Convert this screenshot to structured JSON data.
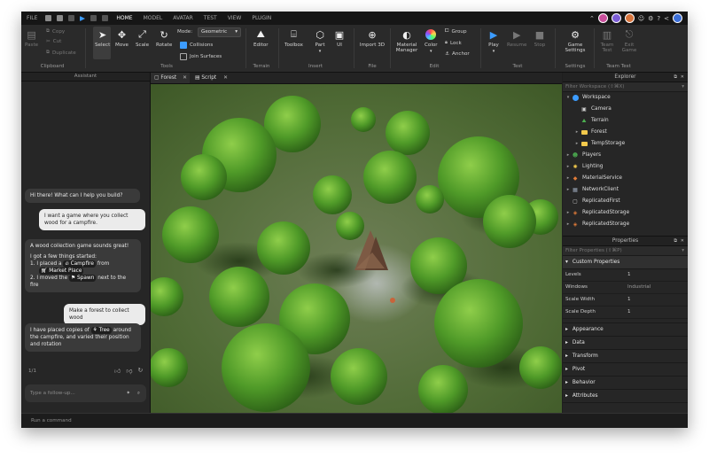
{
  "menu": {
    "file": "FILE",
    "tabs": [
      "HOME",
      "MODEL",
      "AVATAR",
      "TEST",
      "VIEW",
      "PLUGIN"
    ],
    "active_tab": "HOME"
  },
  "ribbon": {
    "clipboard": {
      "paste": "Paste",
      "copy": "Copy",
      "cut": "Cut",
      "duplicate": "Duplicate",
      "label": "Clipboard"
    },
    "tools": {
      "select": "Select",
      "move": "Move",
      "scale": "Scale",
      "rotate": "Rotate",
      "mode_label": "Mode:",
      "mode_value": "Geometric",
      "collisions": "Collisions",
      "join_surfaces": "Join Surfaces",
      "label": "Tools"
    },
    "terrain": {
      "editor": "Editor",
      "label": "Terrain"
    },
    "insert": {
      "toolbox": "Toolbox",
      "part": "Part",
      "ui": "UI",
      "label": "Insert"
    },
    "file": {
      "import": "Import 3D",
      "label": "File"
    },
    "edit": {
      "material_manager": "Material Manager",
      "color": "Color",
      "group": "Group",
      "lock": "Lock",
      "anchor": "Anchor",
      "label": "Edit"
    },
    "test": {
      "play": "Play",
      "resume": "Resume",
      "stop": "Stop",
      "label": "Test"
    },
    "settings": {
      "game_settings": "Game Settings",
      "label": "Settings"
    },
    "team_test": {
      "team_test": "Team Test",
      "exit_game": "Exit Game",
      "label": "Team Test"
    }
  },
  "assistant": {
    "title": "Assistant",
    "messages": {
      "m1": "Hi there! What can I help you build?",
      "m2": "I want a game where you collect wood for a campfire.",
      "m3_a": "A wood collection game sounds great!",
      "m3_b": "I got a few things started:",
      "m3_c1": "1. I placed a",
      "m3_chip1": "Campfire",
      "m3_c2": "from",
      "m3_chip2": "Market Place",
      "m3_d1": "2. I moved the",
      "m3_chip3": "Spawn",
      "m3_d2": "next to the fire",
      "m4": "Make a forest to collect wood",
      "m5_a": "I have placed copies of",
      "m5_chip": "Tree",
      "m5_b": "around the campfire, and varied their position and rotation"
    },
    "pager": "1/1",
    "follow_placeholder": "Type a follow-up..."
  },
  "editor_tabs": [
    {
      "label": "Forest"
    },
    {
      "label": "Script"
    }
  ],
  "explorer": {
    "title": "Explorer",
    "filter": "Filter Workspace (⇧⌘X)",
    "items": [
      {
        "label": "Workspace",
        "color": "#3c9cff"
      },
      {
        "label": "Camera",
        "color": "#cfcfcf"
      },
      {
        "label": "Terrain",
        "color": "#4caf50"
      },
      {
        "label": "Forest",
        "color": "#f2c94c"
      },
      {
        "label": "TempStorage",
        "color": "#f2c94c"
      },
      {
        "label": "Players",
        "color": "#4caf50"
      },
      {
        "label": "Lighting",
        "color": "#f2c94c"
      },
      {
        "label": "MaterialService",
        "color": "#e07b39"
      },
      {
        "label": "NetworkClient",
        "color": "#9aa6b8"
      },
      {
        "label": "ReplicatedFirst",
        "color": "#cfcfcf"
      },
      {
        "label": "ReplicatedStorage",
        "color": "#e07b39"
      },
      {
        "label": "ReplicatedStorage",
        "color": "#e07b39"
      }
    ]
  },
  "properties": {
    "title": "Properties",
    "filter": "Filter Properties (⇧⌘P)",
    "custom_header": "Custom Properties",
    "rows": [
      {
        "k": "Levels",
        "v": "1"
      },
      {
        "k": "Windows",
        "v": "Industrial"
      },
      {
        "k": "Scale Width",
        "v": "1"
      },
      {
        "k": "Scale Depth",
        "v": "1"
      }
    ],
    "sections": [
      "Appearance",
      "Data",
      "Transform",
      "Pivot",
      "Behavior",
      "Attributes"
    ]
  },
  "command_bar": {
    "placeholder": "Run a command"
  }
}
